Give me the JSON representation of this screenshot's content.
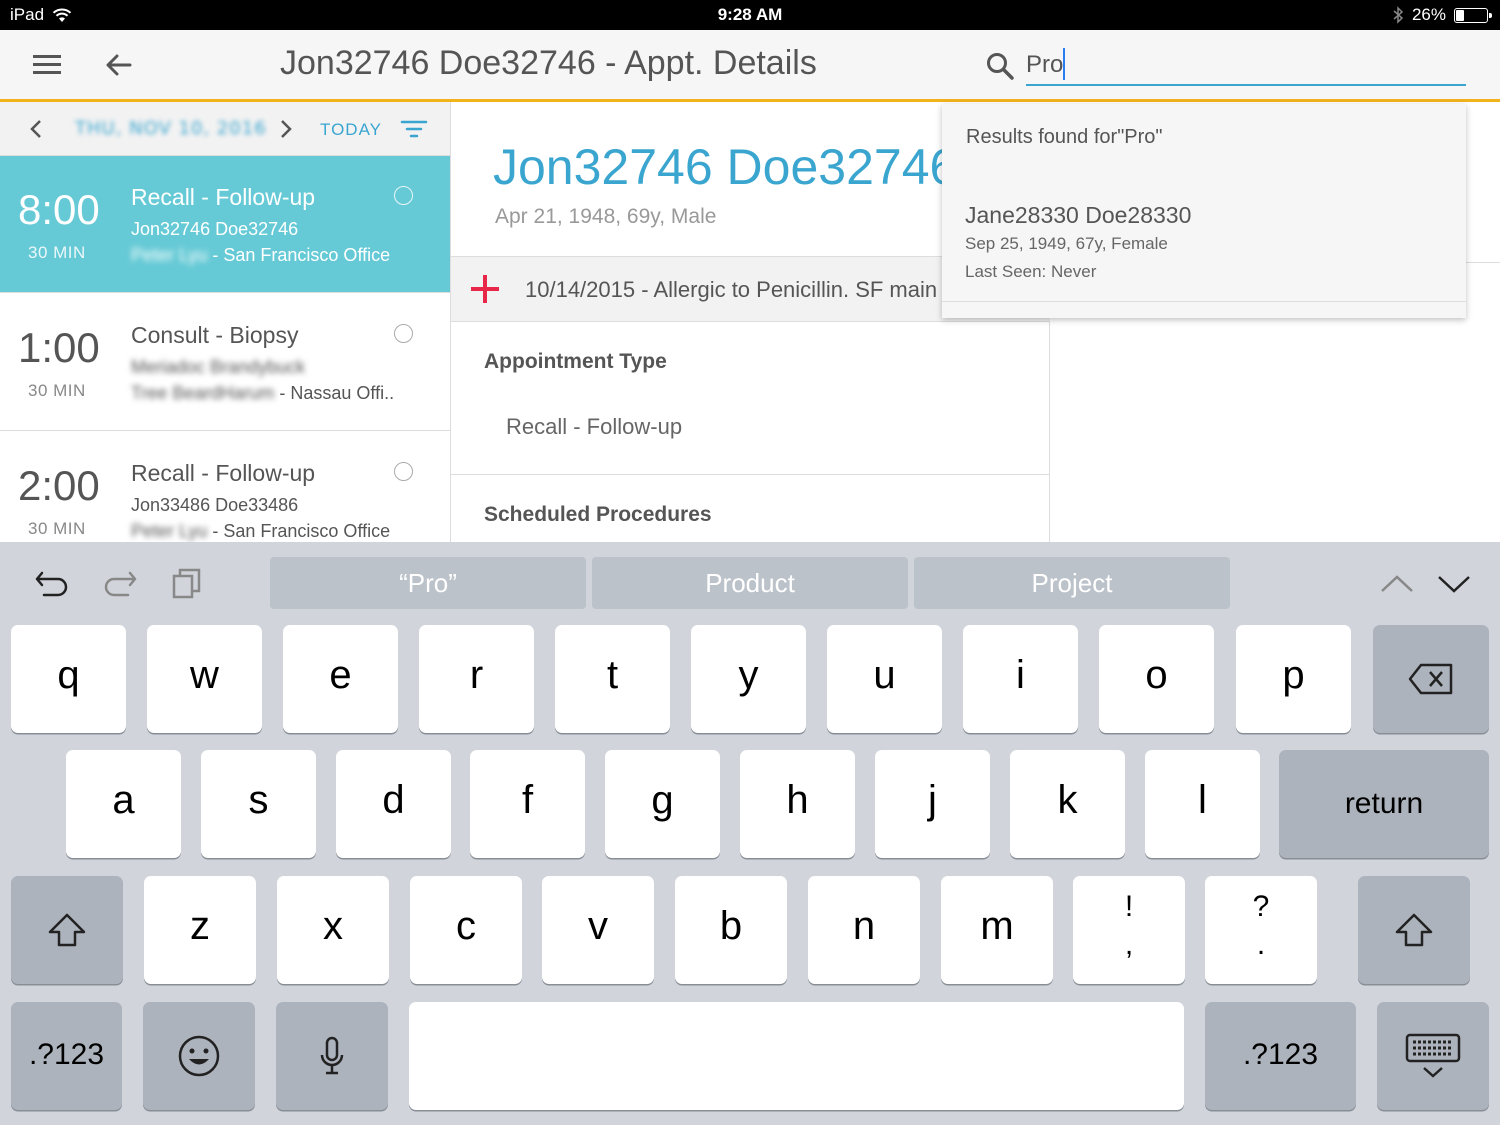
{
  "status_bar": {
    "device": "iPad",
    "time": "9:28 AM",
    "battery": "26%",
    "battery_level": 0.26
  },
  "header": {
    "title": "Jon32746 Doe32746 - Appt. Details",
    "search_value": "Pro",
    "search_placeholder": ""
  },
  "date_nav": {
    "date": "THU, NOV 10, 2016",
    "today_label": "TODAY"
  },
  "appointments": [
    {
      "time": "8:00",
      "duration": "30 MIN",
      "type": "Recall - Follow-up",
      "patient": "Jon32746 Doe32746",
      "provider": "Peter Lyu",
      "location": " - San Francisco Office",
      "active": true
    },
    {
      "time": "1:00",
      "duration": "30 MIN",
      "type": "Consult - Biopsy",
      "patient": "Meriadoc Brandybuck",
      "provider": "Tree BeardHarum",
      "location": " - Nassau Offi..",
      "active": false
    },
    {
      "time": "2:00",
      "duration": "30 MIN",
      "type": "Recall - Follow-up",
      "patient": "Jon33486 Doe33486",
      "provider": "Peter Lyu",
      "location": " - San Francisco Office",
      "active": false
    }
  ],
  "patient": {
    "name": "Jon32746 Doe32746",
    "info": "Apr 21, 1948, 69y, Male",
    "alert": "10/14/2015 - Allergic to Penicillin. SF main"
  },
  "sections": {
    "appointment_type_title": "Appointment Type",
    "appointment_type_value": "Recall - Follow-up",
    "scheduled_procedures_title": "Scheduled Procedures"
  },
  "search_results": {
    "heading": "Results found for\"Pro\"",
    "items": [
      {
        "name": "Jane28330 Doe28330",
        "dob": "Sep 25, 1949, 67y, Female",
        "last_seen": "Last Seen: Never"
      }
    ]
  },
  "keyboard": {
    "suggestions": [
      "“Pro”",
      "Product",
      "Project"
    ],
    "row1": [
      "q",
      "w",
      "e",
      "r",
      "t",
      "y",
      "u",
      "i",
      "o",
      "p"
    ],
    "row2": [
      "a",
      "s",
      "d",
      "f",
      "g",
      "h",
      "j",
      "k",
      "l"
    ],
    "row3": [
      "z",
      "x",
      "c",
      "v",
      "b",
      "n",
      "m"
    ],
    "punct1_top": "!",
    "punct1_bottom": ",",
    "punct2_top": "?",
    "punct2_bottom": ".",
    "return_label": "return",
    "numbers_label": ".?123"
  },
  "colors": {
    "accent": "#3aa6d0",
    "active_row": "#66cad6",
    "header_border": "#f2b21c",
    "alert_plus": "#e8264a"
  }
}
